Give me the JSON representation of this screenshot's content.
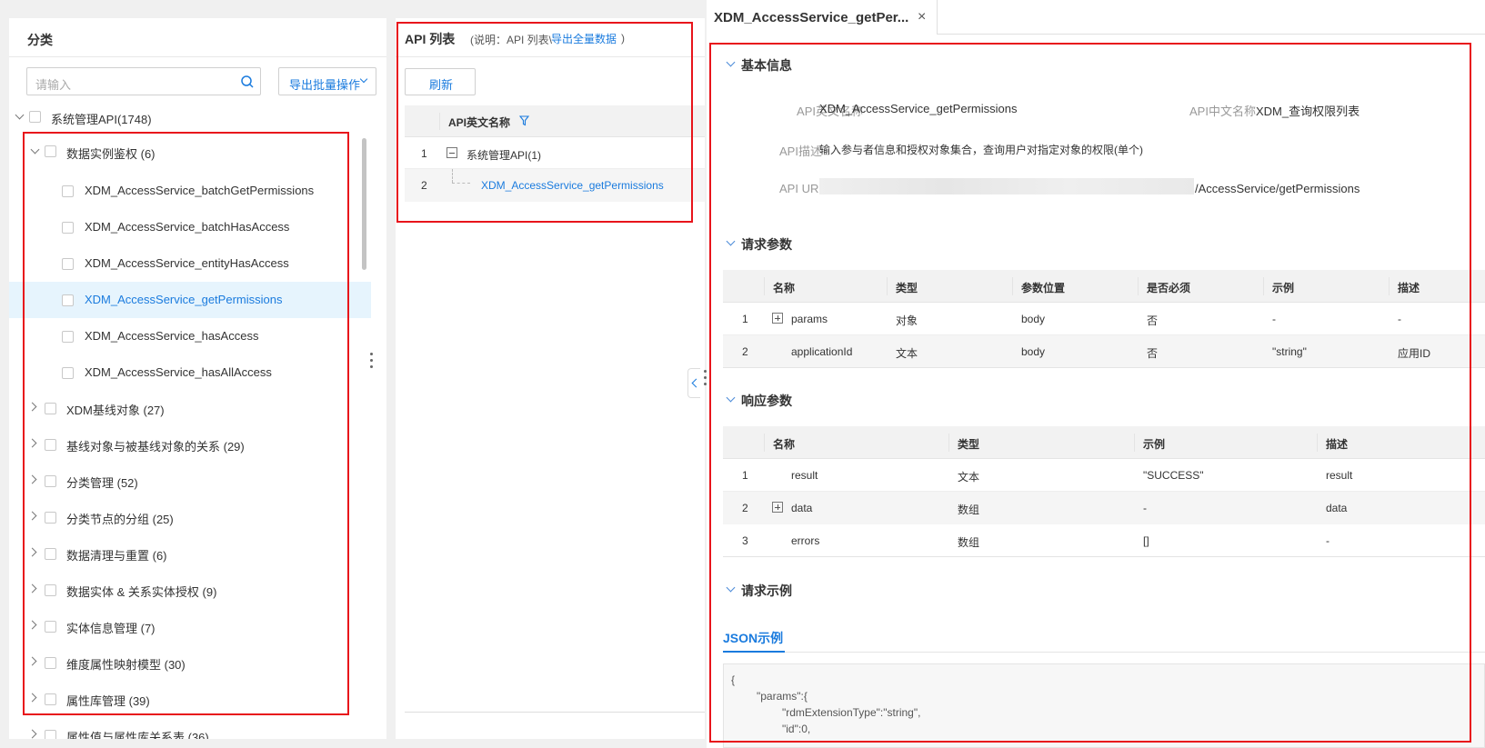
{
  "left": {
    "title": "分类",
    "search_placeholder": "请输入",
    "export_batch_label": "导出批量操作",
    "root": "系统管理API(1748)",
    "group_open": "数据实例鉴权 (6)",
    "children": [
      "XDM_AccessService_batchGetPermissions",
      "XDM_AccessService_batchHasAccess",
      "XDM_AccessService_entityHasAccess",
      "XDM_AccessService_getPermissions",
      "XDM_AccessService_hasAccess",
      "XDM_AccessService_hasAllAccess"
    ],
    "groups": [
      "XDM基线对象 (27)",
      "基线对象与被基线对象的关系 (29)",
      "分类管理 (52)",
      "分类节点的分组 (25)",
      "数据清理与重置 (6)",
      "数据实体 & 关系实体授权 (9)",
      "实体信息管理 (7)",
      "维度属性映射模型 (30)",
      "属性库管理 (39)",
      "属性值与属性库关系表 (36)"
    ]
  },
  "mid": {
    "title": "API 列表",
    "note_prefix": "(说明：API 列表\\",
    "note_link": "导出全量数据",
    "note_suffix": ")",
    "refresh": "刷新",
    "col_header": "API英文名称",
    "rows": [
      {
        "num": "1",
        "name": "系统管理API(1)"
      },
      {
        "num": "2",
        "name": "XDM_AccessService_getPermissions"
      }
    ]
  },
  "right": {
    "tab_title": "XDM_AccessService_getPer...",
    "tab_close": "×",
    "basic": {
      "title": "基本信息",
      "en_label": "API英文名称",
      "en_value": "XDM_AccessService_getPermissions",
      "cn_label": "API中文名称",
      "cn_value": "XDM_查询权限列表",
      "desc_label": "API描述",
      "desc_value": "输入参与者信息和授权对象集合，查询用户对指定对象的权限(单个)",
      "url_label": "API URL",
      "url_value": "/AccessService/getPermissions"
    },
    "req": {
      "title": "请求参数",
      "headers": [
        "名称",
        "类型",
        "参数位置",
        "是否必须",
        "示例",
        "描述"
      ],
      "rows": [
        {
          "num": "1",
          "name": "params",
          "type": "对象",
          "pos": "body",
          "req": "否",
          "ex": "-",
          "desc": "-"
        },
        {
          "num": "2",
          "name": "applicationId",
          "type": "文本",
          "pos": "body",
          "req": "否",
          "ex": "\"string\"",
          "desc": "应用ID"
        }
      ]
    },
    "resp": {
      "title": "响应参数",
      "headers": [
        "名称",
        "类型",
        "示例",
        "描述"
      ],
      "rows": [
        {
          "num": "1",
          "name": "result",
          "type": "文本",
          "ex": "\"SUCCESS\"",
          "desc": "result"
        },
        {
          "num": "2",
          "name": "data",
          "type": "数组",
          "ex": "-",
          "desc": "data"
        },
        {
          "num": "3",
          "name": "errors",
          "type": "数组",
          "ex": "[]",
          "desc": "-"
        }
      ]
    },
    "example": {
      "title": "请求示例",
      "tab": "JSON示例",
      "lines": [
        "{",
        "\"params\":{",
        "\"rdmExtensionType\":\"string\",",
        "\"id\":0,"
      ]
    }
  }
}
